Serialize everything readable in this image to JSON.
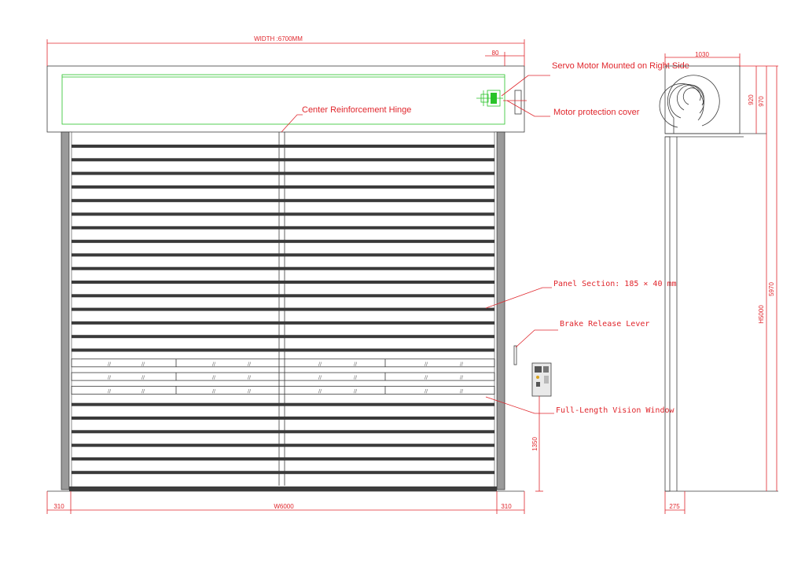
{
  "dimensions": {
    "overall_width": "WIDTH :6700MM",
    "motor_offset": "80",
    "left_guide": "310",
    "opening_width": "W6000",
    "right_guide": "310",
    "control_height": "1350",
    "side_depth": "1030",
    "box_height_920": "920",
    "box_height_970": "970",
    "total_height": "5970",
    "opening_height": "H5000",
    "side_rail": "275"
  },
  "annotations": {
    "servo_motor": "Servo Motor Mounted on Right Side",
    "motor_cover": "Motor protection cover",
    "hinge": "Center Reinforcement Hinge",
    "panel_section": "Panel Section: 185 × 40 mm",
    "brake_lever": "Brake Release Lever",
    "vision_window": "Full-Length Vision Window"
  },
  "colors": {
    "annotation": "#e0262c",
    "motor": "#29c329",
    "line": "#3c3c3c"
  }
}
